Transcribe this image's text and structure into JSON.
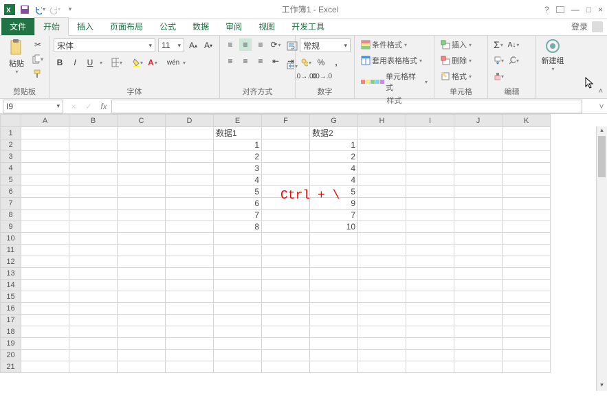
{
  "titlebar": {
    "title": "工作簿1 - Excel"
  },
  "tabs": {
    "file": "文件",
    "home": "开始",
    "insert": "插入",
    "layout": "页面布局",
    "formulas": "公式",
    "data": "数据",
    "review": "审阅",
    "view": "视图",
    "developer": "开发工具",
    "login": "登录"
  },
  "ribbon": {
    "clipboard": {
      "label": "剪贴板",
      "paste": "粘贴"
    },
    "font": {
      "label": "字体",
      "name": "宋体",
      "size": "11",
      "bold": "B",
      "italic": "I",
      "underline": "U",
      "pinyin": "wén"
    },
    "align": {
      "label": "对齐方式"
    },
    "number": {
      "label": "数字",
      "format": "常规"
    },
    "styles": {
      "label": "样式",
      "cond": "条件格式",
      "table": "套用表格格式",
      "cell": "单元格样式"
    },
    "cells": {
      "label": "单元格",
      "insert": "插入",
      "delete": "删除",
      "format": "格式"
    },
    "editing": {
      "label": "编辑"
    },
    "newgroup": {
      "label": "新建组"
    }
  },
  "formula_bar": {
    "name_box": "I9",
    "formula": ""
  },
  "columns": [
    "A",
    "B",
    "C",
    "D",
    "E",
    "F",
    "G",
    "H",
    "I",
    "J",
    "K"
  ],
  "rows": [
    1,
    2,
    3,
    4,
    5,
    6,
    7,
    8,
    9,
    10,
    11,
    12,
    13,
    14,
    15,
    16,
    17,
    18,
    19,
    20,
    21
  ],
  "cells": {
    "E": [
      "数据1",
      "1",
      "2",
      "3",
      "4",
      "5",
      "6",
      "7",
      "8"
    ],
    "G": [
      "数据2",
      "1",
      "2",
      "4",
      "4",
      "5",
      "9",
      "7",
      "10"
    ]
  },
  "overlay": "Ctrl + \\"
}
